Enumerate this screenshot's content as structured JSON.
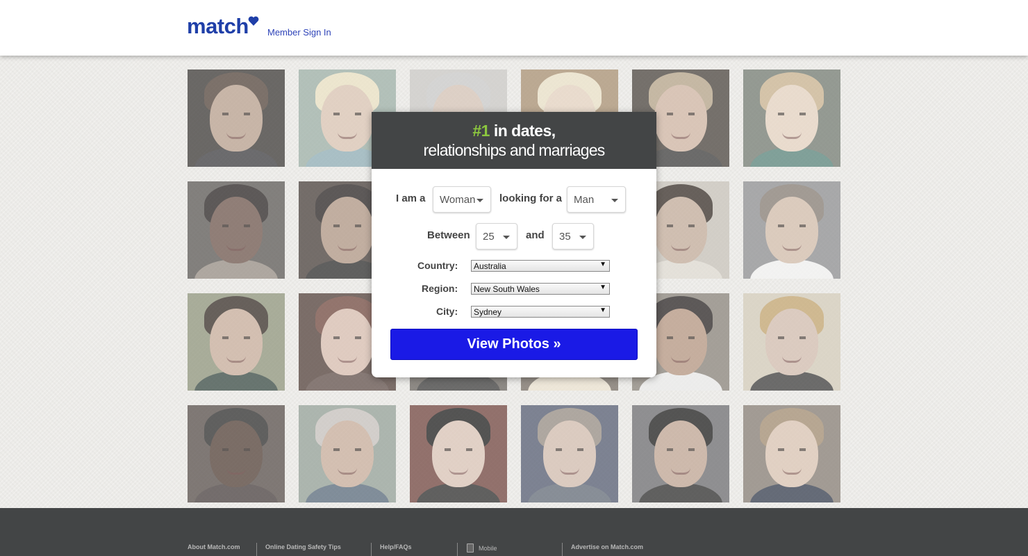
{
  "brand": {
    "logo_text": "match",
    "accent": "#2e43b8",
    "heart_color": "#1f3fa8"
  },
  "header": {
    "signin_label": "Member Sign In"
  },
  "modal": {
    "tagline_number": "#1",
    "tagline_rest": " in dates,",
    "tagline_line2": "relationships and marriages",
    "i_am_label": "I am a",
    "gender_value": "Woman",
    "looking_for_label": "looking for a",
    "seeking_value": "Man",
    "between_label": "Between",
    "age_min": "25",
    "and_label": "and",
    "age_max": "35",
    "country_label": "Country:",
    "country_value": "Australia",
    "region_label": "Region:",
    "region_value": "New South Wales",
    "city_label": "City:",
    "city_value": "Sydney",
    "submit_label": "View Photos »",
    "button_color": "#1a1ae6"
  },
  "footer": {
    "links": [
      "About Match.com",
      "Online Dating Safety Tips",
      "Help/FAQs",
      "Mobile",
      "Advertise on Match.com"
    ]
  }
}
